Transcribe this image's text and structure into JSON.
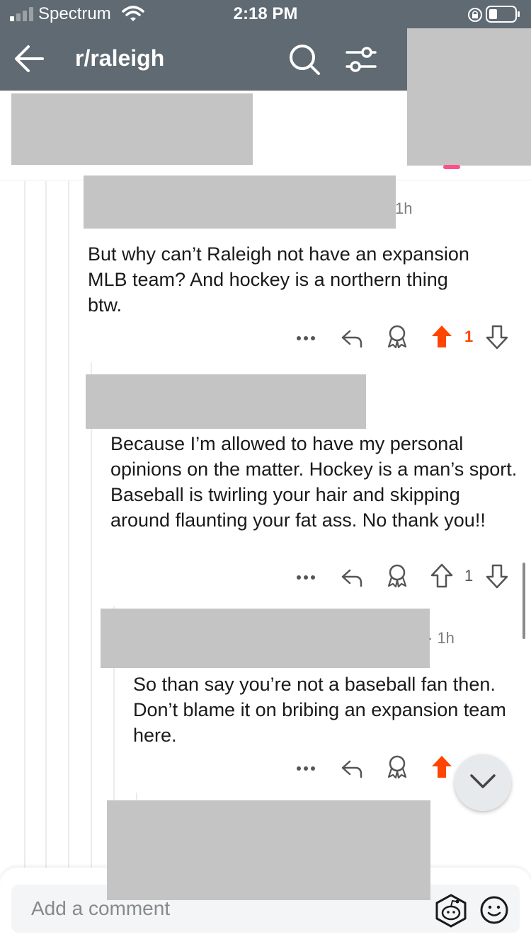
{
  "status_bar": {
    "carrier": "Spectrum",
    "time": "2:18 PM"
  },
  "header": {
    "title": "r/raleigh"
  },
  "comments": [
    {
      "time": "1h",
      "body": "But why can’t Raleigh not have an expansion MLB team? And hockey is a northern thing btw.",
      "votes": "1",
      "upvoted": true
    },
    {
      "body": "Because I’m allowed to have my personal opinions on the matter. Hockey is a man’s sport. Baseball is twirling your hair and skipping around flaunting your fat ass. No thank you!!",
      "votes": "1",
      "upvoted": false
    },
    {
      "time": "· 1h",
      "body": "So than say you’re not a baseball fan then. Don’t blame it on bribing an expansion team here.",
      "upvoted": true
    }
  ],
  "composer": {
    "placeholder": "Add a comment"
  },
  "colors": {
    "header_bg": "#5f6a72",
    "upvote_orange": "#ff4500",
    "redaction_gray": "#c4c4c4"
  },
  "icons": [
    "signal-icon",
    "wifi-icon",
    "rotation-lock-icon",
    "battery-icon",
    "back-arrow-icon",
    "search-icon",
    "filter-icon",
    "more-icon",
    "reply-icon",
    "award-icon",
    "upvote-icon",
    "downvote-icon",
    "chevron-down-icon",
    "snoo-icon",
    "emoji-icon"
  ]
}
